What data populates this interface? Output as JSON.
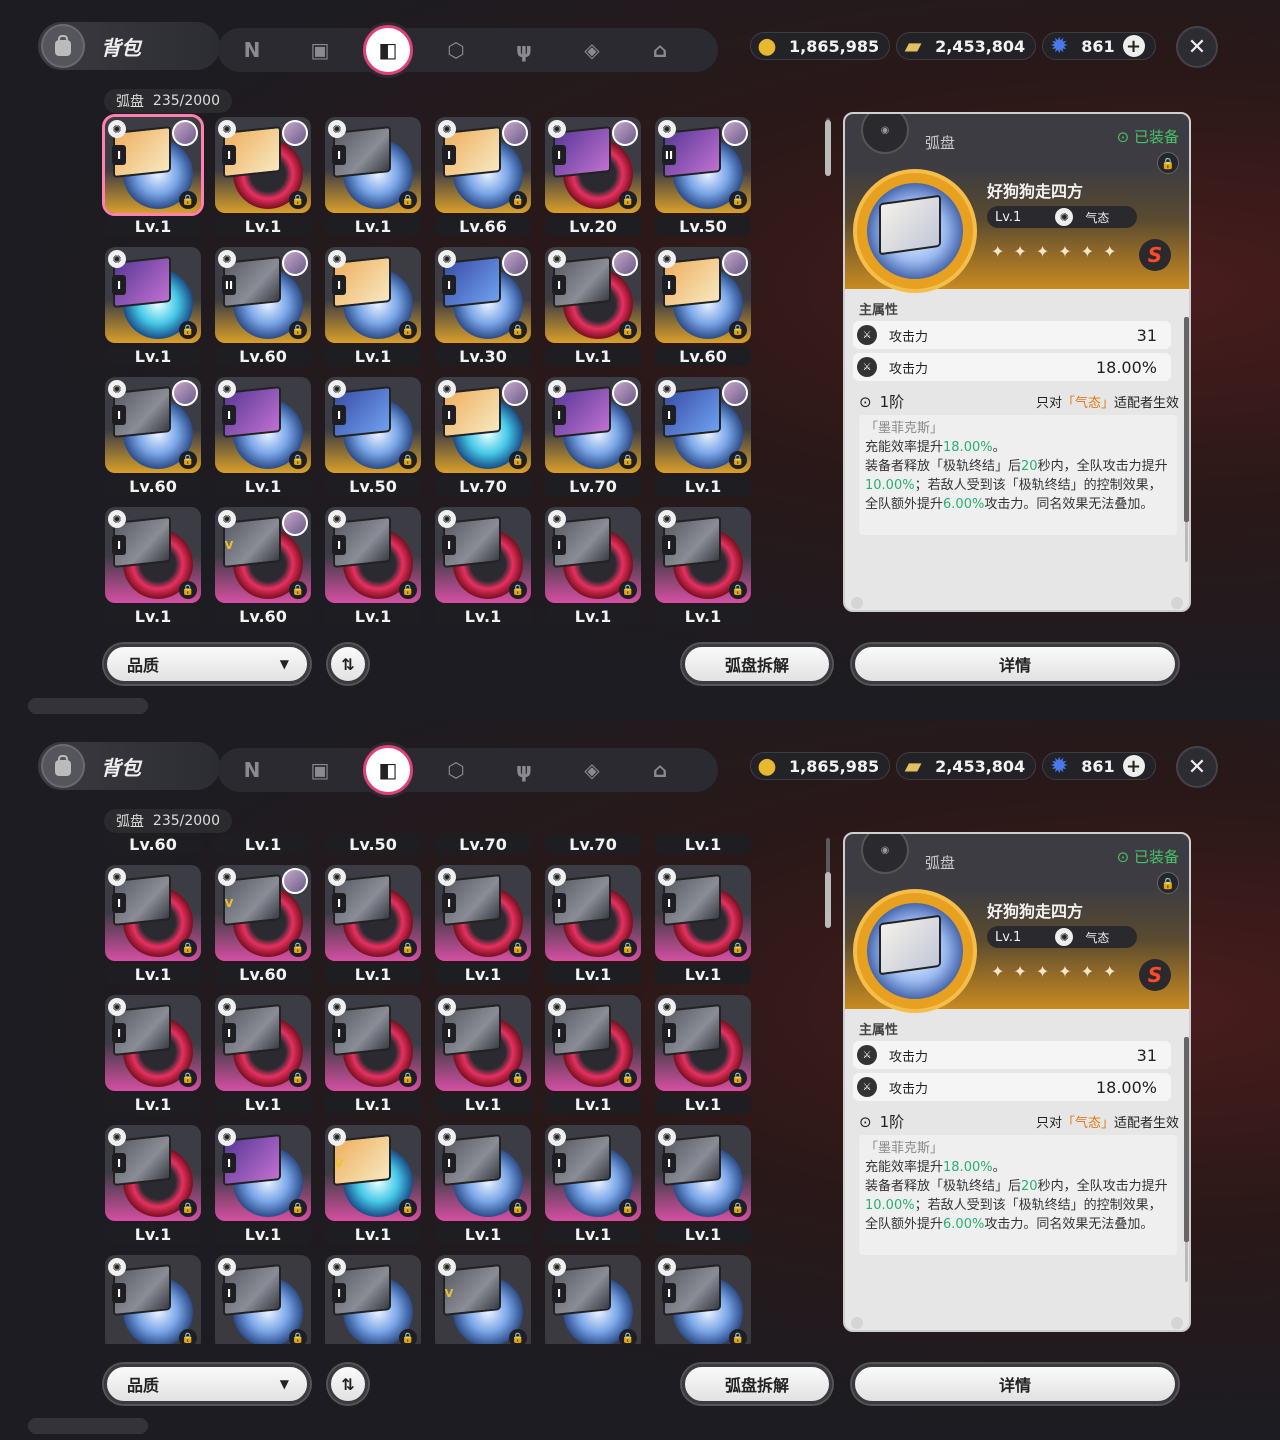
{
  "header": {
    "title": "背包",
    "tabs": [
      "n-icon",
      "gameboy-icon",
      "disc-icon",
      "box-icon",
      "fork-knife-icon",
      "cube-shield-icon",
      "home-icon"
    ],
    "active_tab": 2
  },
  "currencies": [
    {
      "icon": "coin-icon",
      "value": "1,865,985"
    },
    {
      "icon": "ticket-icon",
      "value": "2,453,804"
    },
    {
      "icon": "crystal-icon",
      "value": "861"
    }
  ],
  "inventory": {
    "label": "弧盘",
    "count": "235/2000"
  },
  "grid_top": {
    "rows": [
      [
        {
          "lv": "Lv.1",
          "bg": "gold",
          "rank": "I",
          "disc": "blue",
          "art": "warm",
          "avatar": true,
          "sel": true
        },
        {
          "lv": "Lv.1",
          "bg": "gold",
          "rank": "I",
          "disc": "red",
          "art": "warm",
          "avatar": true
        },
        {
          "lv": "Lv.1",
          "bg": "gold",
          "rank": "I",
          "disc": "blue",
          "art": "grey",
          "avatar": false
        },
        {
          "lv": "Lv.66",
          "bg": "gold",
          "rank": "I",
          "disc": "blue",
          "art": "warm",
          "avatar": true
        },
        {
          "lv": "Lv.20",
          "bg": "gold",
          "rank": "I",
          "disc": "red",
          "art": "purple",
          "avatar": true
        },
        {
          "lv": "Lv.50",
          "bg": "gold",
          "rank": "II",
          "disc": "blue",
          "art": "purple",
          "avatar": true
        }
      ],
      [
        {
          "lv": "Lv.1",
          "bg": "gold",
          "rank": "I",
          "disc": "cyan",
          "art": "purple",
          "avatar": false
        },
        {
          "lv": "Lv.60",
          "bg": "gold",
          "rank": "II",
          "disc": "blue",
          "art": "grey",
          "avatar": true
        },
        {
          "lv": "Lv.1",
          "bg": "gold",
          "rank": "I",
          "disc": "blue",
          "art": "warm",
          "avatar": false
        },
        {
          "lv": "Lv.30",
          "bg": "gold",
          "rank": "I",
          "disc": "blue",
          "art": "blue",
          "avatar": true
        },
        {
          "lv": "Lv.1",
          "bg": "gold",
          "rank": "I",
          "disc": "red",
          "art": "grey",
          "avatar": true
        },
        {
          "lv": "Lv.60",
          "bg": "gold",
          "rank": "I",
          "disc": "blue",
          "art": "warm",
          "avatar": true
        }
      ],
      [
        {
          "lv": "Lv.60",
          "bg": "gold",
          "rank": "I",
          "disc": "blue",
          "art": "grey",
          "avatar": true
        },
        {
          "lv": "Lv.1",
          "bg": "gold",
          "rank": "I",
          "disc": "blue",
          "art": "purple",
          "avatar": false
        },
        {
          "lv": "Lv.50",
          "bg": "gold",
          "rank": "I",
          "disc": "blue",
          "art": "blue",
          "avatar": false
        },
        {
          "lv": "Lv.70",
          "bg": "gold",
          "rank": "I",
          "disc": "cyan",
          "art": "warm",
          "avatar": true
        },
        {
          "lv": "Lv.70",
          "bg": "gold",
          "rank": "I",
          "disc": "blue",
          "art": "purple",
          "avatar": true
        },
        {
          "lv": "Lv.1",
          "bg": "gold",
          "rank": "I",
          "disc": "blue",
          "art": "blue",
          "avatar": true
        }
      ],
      [
        {
          "lv": "Lv.1",
          "bg": "pink",
          "rank": "I",
          "disc": "red",
          "art": "grey",
          "avatar": false
        },
        {
          "lv": "Lv.60",
          "bg": "pink",
          "rank": "V",
          "disc": "red",
          "art": "grey",
          "avatar": true
        },
        {
          "lv": "Lv.1",
          "bg": "pink",
          "rank": "I",
          "disc": "red",
          "art": "grey",
          "avatar": false
        },
        {
          "lv": "Lv.1",
          "bg": "pink",
          "rank": "I",
          "disc": "red",
          "art": "grey",
          "avatar": false
        },
        {
          "lv": "Lv.1",
          "bg": "pink",
          "rank": "I",
          "disc": "red",
          "art": "grey",
          "avatar": false
        },
        {
          "lv": "Lv.1",
          "bg": "pink",
          "rank": "I",
          "disc": "red",
          "art": "grey",
          "avatar": false
        }
      ]
    ]
  },
  "grid_bottom": {
    "rows": [
      [
        {
          "lv": "Lv.60",
          "bg": "gold",
          "rank": "I",
          "disc": "blue",
          "art": "grey",
          "avatar": true
        },
        {
          "lv": "Lv.1",
          "bg": "gold",
          "rank": "I",
          "disc": "blue",
          "art": "purple",
          "avatar": false
        },
        {
          "lv": "Lv.50",
          "bg": "gold",
          "rank": "I",
          "disc": "blue",
          "art": "blue",
          "avatar": false
        },
        {
          "lv": "Lv.70",
          "bg": "gold",
          "rank": "I",
          "disc": "cyan",
          "art": "warm",
          "avatar": true
        },
        {
          "lv": "Lv.70",
          "bg": "gold",
          "rank": "I",
          "disc": "blue",
          "art": "purple",
          "avatar": true
        },
        {
          "lv": "Lv.1",
          "bg": "gold",
          "rank": "I",
          "disc": "blue",
          "art": "blue",
          "avatar": true
        }
      ],
      [
        {
          "lv": "Lv.1",
          "bg": "pink",
          "rank": "I",
          "disc": "red",
          "art": "grey",
          "avatar": false
        },
        {
          "lv": "Lv.60",
          "bg": "pink",
          "rank": "V",
          "disc": "red",
          "art": "grey",
          "avatar": true
        },
        {
          "lv": "Lv.1",
          "bg": "pink",
          "rank": "I",
          "disc": "red",
          "art": "grey",
          "avatar": false
        },
        {
          "lv": "Lv.1",
          "bg": "pink",
          "rank": "I",
          "disc": "red",
          "art": "grey",
          "avatar": false
        },
        {
          "lv": "Lv.1",
          "bg": "pink",
          "rank": "I",
          "disc": "red",
          "art": "grey",
          "avatar": false
        },
        {
          "lv": "Lv.1",
          "bg": "pink",
          "rank": "I",
          "disc": "red",
          "art": "grey",
          "avatar": false
        }
      ],
      [
        {
          "lv": "Lv.1",
          "bg": "pink",
          "rank": "I",
          "disc": "red",
          "art": "grey",
          "avatar": false
        },
        {
          "lv": "Lv.1",
          "bg": "pink",
          "rank": "I",
          "disc": "red",
          "art": "grey",
          "avatar": false
        },
        {
          "lv": "Lv.1",
          "bg": "pink",
          "rank": "I",
          "disc": "red",
          "art": "grey",
          "avatar": false
        },
        {
          "lv": "Lv.1",
          "bg": "pink",
          "rank": "I",
          "disc": "red",
          "art": "grey",
          "avatar": false
        },
        {
          "lv": "Lv.1",
          "bg": "pink",
          "rank": "I",
          "disc": "red",
          "art": "grey",
          "avatar": false
        },
        {
          "lv": "Lv.1",
          "bg": "pink",
          "rank": "I",
          "disc": "red",
          "art": "grey",
          "avatar": false
        }
      ],
      [
        {
          "lv": "Lv.1",
          "bg": "pink",
          "rank": "I",
          "disc": "red",
          "art": "grey",
          "avatar": false
        },
        {
          "lv": "Lv.1",
          "bg": "pink",
          "rank": "I",
          "disc": "blue",
          "art": "purple",
          "avatar": false
        },
        {
          "lv": "Lv.1",
          "bg": "pink",
          "rank": "V",
          "disc": "cyan",
          "art": "warm",
          "avatar": false
        },
        {
          "lv": "Lv.1",
          "bg": "pink",
          "rank": "I",
          "disc": "blue",
          "art": "grey",
          "avatar": false
        },
        {
          "lv": "Lv.1",
          "bg": "pink",
          "rank": "I",
          "disc": "blue",
          "art": "grey",
          "avatar": false
        },
        {
          "lv": "Lv.1",
          "bg": "pink",
          "rank": "I",
          "disc": "blue",
          "art": "grey",
          "avatar": false
        }
      ],
      [
        {
          "lv": "",
          "bg": "grey",
          "rank": "I",
          "disc": "blue",
          "art": "grey",
          "avatar": false
        },
        {
          "lv": "",
          "bg": "grey",
          "rank": "I",
          "disc": "blue",
          "art": "grey",
          "avatar": false
        },
        {
          "lv": "",
          "bg": "grey",
          "rank": "I",
          "disc": "blue",
          "art": "grey",
          "avatar": false
        },
        {
          "lv": "",
          "bg": "grey",
          "rank": "V",
          "disc": "blue",
          "art": "grey",
          "avatar": false
        },
        {
          "lv": "",
          "bg": "grey",
          "rank": "I",
          "disc": "blue",
          "art": "grey",
          "avatar": false
        },
        {
          "lv": "",
          "bg": "grey",
          "rank": "I",
          "disc": "blue",
          "art": "grey",
          "avatar": false
        }
      ]
    ]
  },
  "detail": {
    "category": "弧盘",
    "equipped": "已装备",
    "name": "好狗狗走四方",
    "level": "Lv.1",
    "attribute": "气态",
    "rank_letter": "S",
    "main_stats_label": "主属性",
    "stats": [
      {
        "name": "攻击力",
        "value": "31"
      },
      {
        "name": "攻击力",
        "value": "18.00%"
      }
    ],
    "tier": "1阶",
    "condition_prefix": "只对",
    "condition_attr": "「气态」",
    "condition_suffix": "适配者生效",
    "effect_name": "「墨菲克斯」",
    "effect_parts": [
      {
        "t": "充能效率提升",
        "hl": false
      },
      {
        "t": "18.00%",
        "hl": true
      },
      {
        "t": "。\n装备者释放「极轨终结」后",
        "hl": false
      },
      {
        "t": "20",
        "hl": true
      },
      {
        "t": "秒内，全队攻击力提升",
        "hl": false
      },
      {
        "t": "10.00%",
        "hl": true
      },
      {
        "t": "；若敌人受到该「极轨终结」的控制效果，全队额外提升",
        "hl": false
      },
      {
        "t": "6.00%",
        "hl": true
      },
      {
        "t": "攻击力。同名效果无法叠加。",
        "hl": false
      }
    ]
  },
  "buttons": {
    "quality": "品质",
    "disassemble": "弧盘拆解",
    "details": "详情"
  },
  "colors": {
    "equipped": "#49c26a",
    "highlight": "#2bb070",
    "condition": "#e0781a",
    "selection": "#ff7fb0"
  }
}
